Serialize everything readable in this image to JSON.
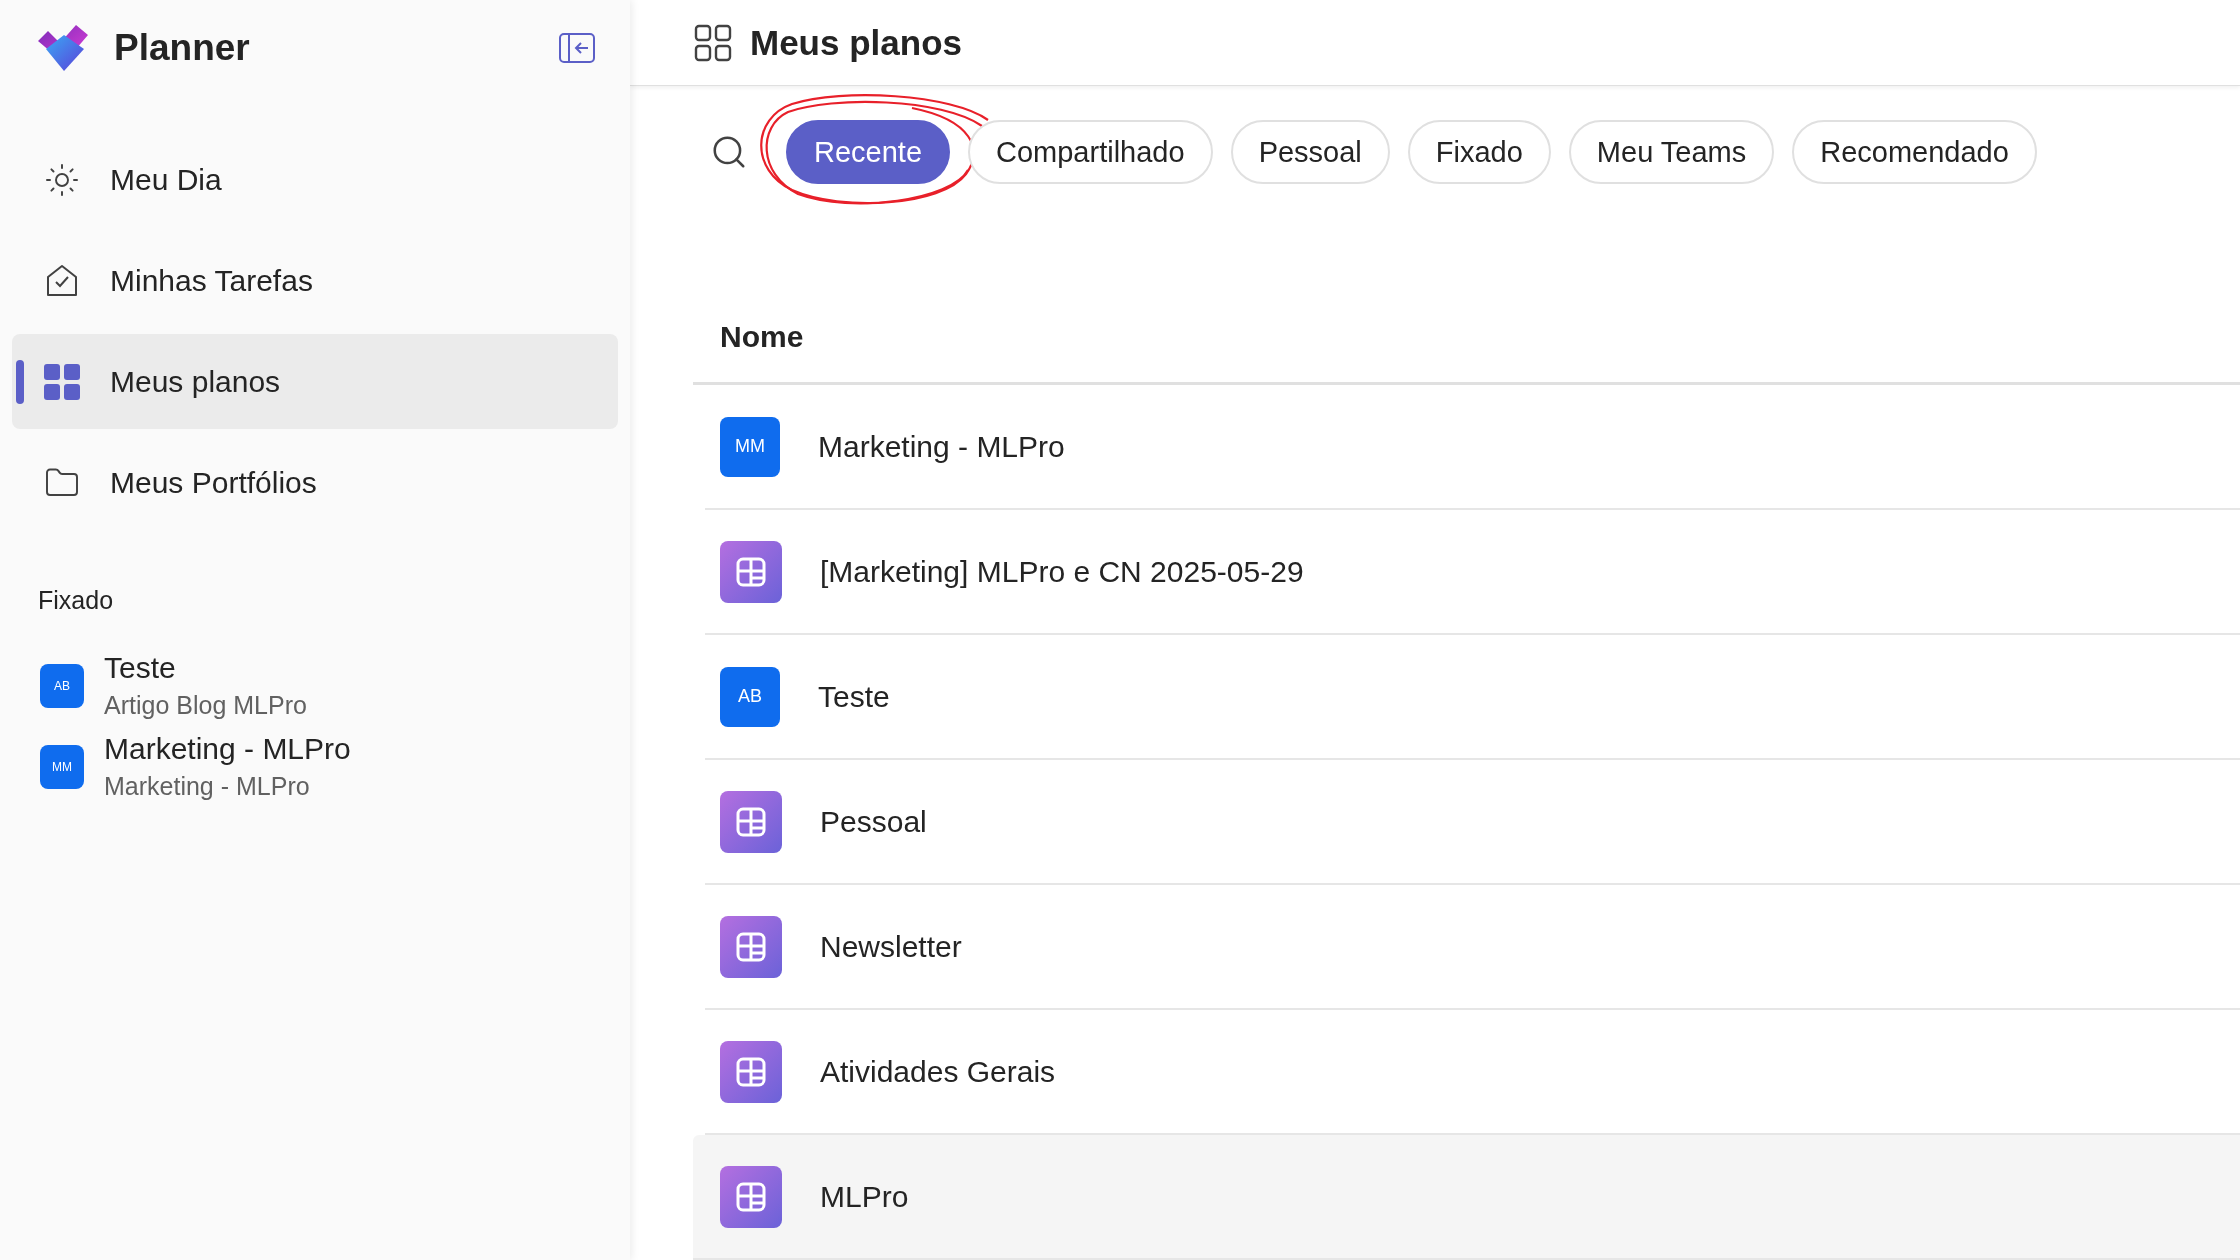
{
  "app": {
    "title": "Planner"
  },
  "nav": [
    {
      "label": "Meu Dia",
      "kind": "sun",
      "selected": false
    },
    {
      "label": "Minhas Tarefas",
      "kind": "tasks",
      "selected": false
    },
    {
      "label": "Meus planos",
      "kind": "grid",
      "selected": true
    },
    {
      "label": "Meus Portfólios",
      "kind": "folder",
      "selected": false
    }
  ],
  "pinned": {
    "title": "Fixado",
    "items": [
      {
        "initials": "AB",
        "name": "Teste",
        "subtitle": "Artigo Blog MLPro"
      },
      {
        "initials": "MM",
        "name": "Marketing - MLPro",
        "subtitle": "Marketing - MLPro"
      }
    ]
  },
  "page": {
    "title": "Meus planos"
  },
  "filters": [
    {
      "label": "Recente",
      "selected": true,
      "circled": true
    },
    {
      "label": "Compartilhado",
      "selected": false,
      "circled": false
    },
    {
      "label": "Pessoal",
      "selected": false,
      "circled": false
    },
    {
      "label": "Fixado",
      "selected": false,
      "circled": false
    },
    {
      "label": "Meu Teams",
      "selected": false,
      "circled": false
    },
    {
      "label": "Recomendado",
      "selected": false,
      "circled": false
    }
  ],
  "table": {
    "columns": [
      "Nome"
    ],
    "rows": [
      {
        "kind": "initials",
        "initials": "MM",
        "name": "Marketing - MLPro",
        "hovered": false
      },
      {
        "kind": "board",
        "name": "[Marketing] MLPro e CN 2025-05-29",
        "hovered": false
      },
      {
        "kind": "initials",
        "initials": "AB",
        "name": "Teste",
        "hovered": false
      },
      {
        "kind": "board",
        "name": "Pessoal",
        "hovered": false
      },
      {
        "kind": "board",
        "name": "Newsletter",
        "hovered": false
      },
      {
        "kind": "board",
        "name": "Atividades Gerais",
        "hovered": false
      },
      {
        "kind": "board",
        "name": "MLPro",
        "hovered": true
      }
    ]
  }
}
